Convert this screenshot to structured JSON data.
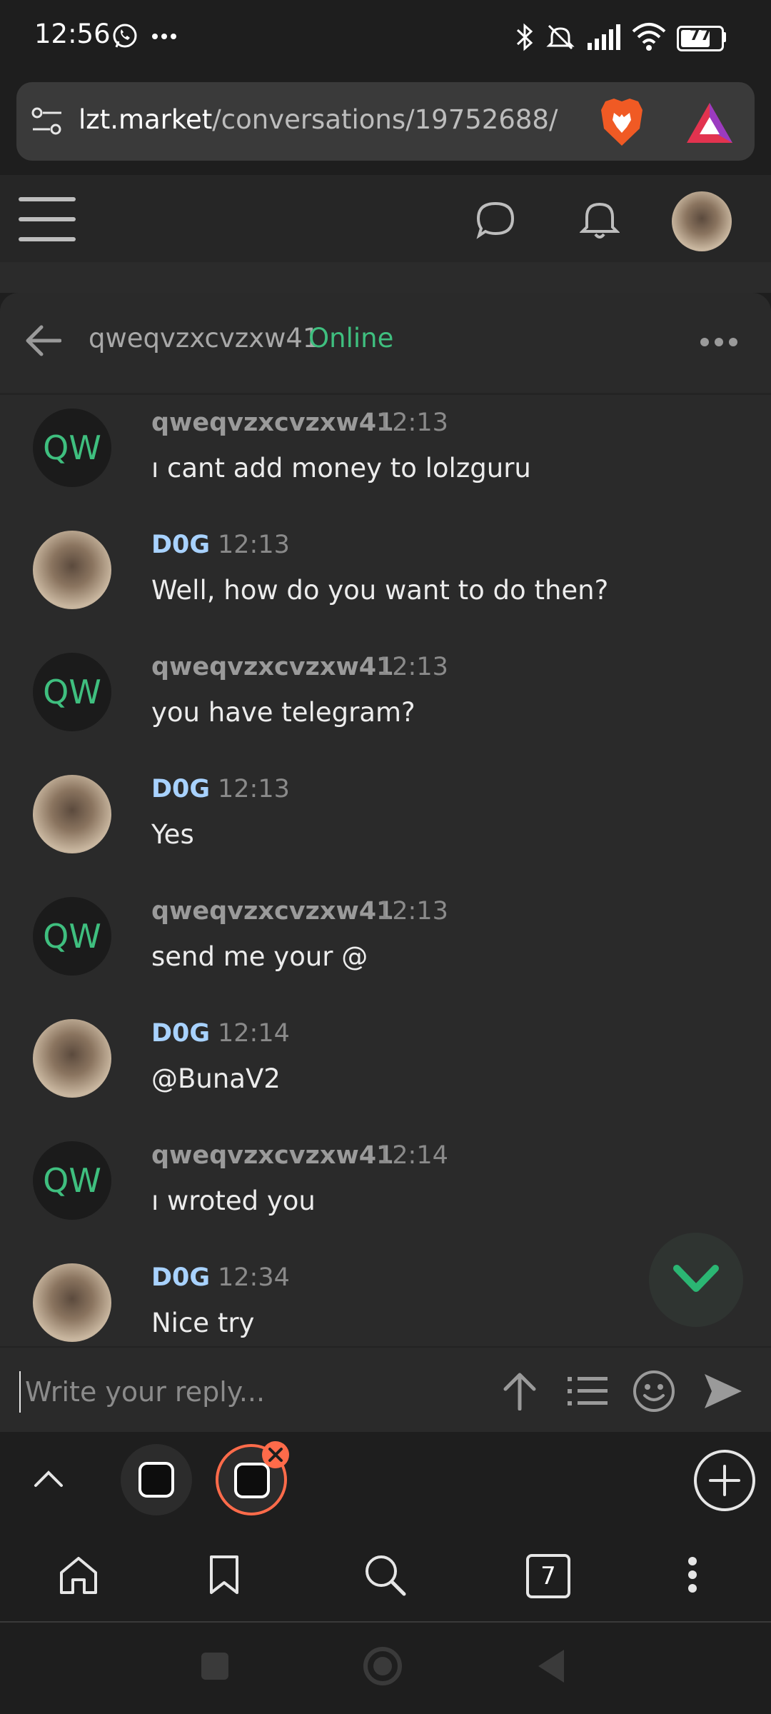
{
  "status_bar": {
    "time": "12:56",
    "battery": "77"
  },
  "browser": {
    "url_host": "lzt.market",
    "url_path": "/conversations/19752688/",
    "tab_count": "7"
  },
  "conversation": {
    "username": "qweqvzxcvzxw41",
    "status": "Online",
    "messages": [
      {
        "author": "qweqvzxcvzxw41",
        "avatar_text": "QW",
        "time": "12:13",
        "text": "ı cant add money to lolzguru"
      },
      {
        "author": "D0G",
        "time": "12:13",
        "text": "Well, how do you want to do then?"
      },
      {
        "author": "qweqvzxcvzxw41",
        "avatar_text": "QW",
        "time": "12:13",
        "text": "you have telegram?"
      },
      {
        "author": "D0G",
        "time": "12:13",
        "text": "Yes"
      },
      {
        "author": "qweqvzxcvzxw41",
        "avatar_text": "QW",
        "time": "12:13",
        "text": "send me your @"
      },
      {
        "author": "D0G",
        "time": "12:14",
        "text": "@BunaV2"
      },
      {
        "author": "qweqvzxcvzxw41",
        "avatar_text": "QW",
        "time": "12:14",
        "text": "ı wroted you"
      },
      {
        "author": "D0G",
        "time": "12:34",
        "text": "Nice try"
      }
    ]
  },
  "reply": {
    "placeholder": "Write your reply..."
  },
  "colors": {
    "online": "#3fbf7f",
    "dog_name": "#a8d2ff",
    "fab_check": "#2bb673",
    "close_badge": "#ff6b4a"
  }
}
